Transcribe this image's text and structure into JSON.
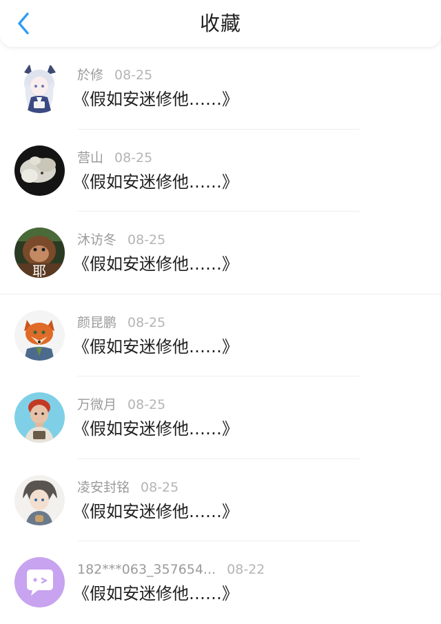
{
  "header": {
    "title": "收藏",
    "back_icon": "chevron-left-icon",
    "accent_color": "#2f9cf4"
  },
  "items": [
    {
      "name": "於修",
      "date": "08-25",
      "content": "《假如安迷修他……》",
      "avatar_icon": "anime-girl-avatar"
    },
    {
      "name": "营山",
      "date": "08-25",
      "content": "《假如安迷修他……》",
      "avatar_icon": "plush-avatar"
    },
    {
      "name": "沐访冬",
      "date": "08-25",
      "content": "《假如安迷修他……》",
      "avatar_icon": "monkey-avatar",
      "avatar_text": "耶"
    },
    {
      "name": "颜昆鹏",
      "date": "08-25",
      "content": "《假如安迷修他……》",
      "avatar_icon": "fox-avatar"
    },
    {
      "name": "万微月",
      "date": "08-25",
      "content": "《假如安迷修他……》",
      "avatar_icon": "person-avatar"
    },
    {
      "name": "凌安封铭",
      "date": "08-25",
      "content": "《假如安迷修他……》",
      "avatar_icon": "anime-boy-avatar"
    },
    {
      "name": "182***063_357654...",
      "date": "08-22",
      "content": "《假如安迷修他……》",
      "avatar_icon": "chat-bubble-avatar"
    }
  ]
}
